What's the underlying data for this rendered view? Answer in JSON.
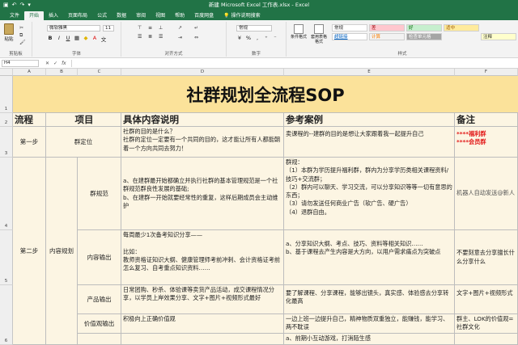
{
  "window": {
    "title": "新建 Microsoft Excel 工作表.xlsx  -  Excel"
  },
  "tabs": [
    "文件",
    "开始",
    "插入",
    "页面布局",
    "公式",
    "数据",
    "审阅",
    "视图",
    "帮助",
    "百度网盘"
  ],
  "tell_me": "操作说明搜索",
  "ribbon": {
    "paste_label": "粘贴",
    "clipboard_label": "剪贴板",
    "font_name": "微软雅黑",
    "font_size": "11",
    "font_label": "字体",
    "alignment_label": "对齐方式",
    "number_format": "常规",
    "number_label": "数字",
    "cond_format_label": "条件格式",
    "table_format_label": "套用表格格式",
    "styles_label": "样式",
    "styles": [
      "常规",
      "差",
      "好",
      "适中",
      "",
      "超链接",
      "计算",
      "检查单元格",
      "",
      "注释"
    ]
  },
  "formula_bar": {
    "name_box": "H4",
    "fx": "fx"
  },
  "columns": [
    "A",
    "B",
    "C",
    "D",
    "E",
    "F"
  ],
  "rows": [
    "1",
    "2",
    "3",
    "4",
    "5",
    "6"
  ],
  "sheet": {
    "title": "社群规划全流程SOP",
    "headers": {
      "a": "流程",
      "b": "项目",
      "d": "具体内容说明",
      "e": "参考案例",
      "f": "备注"
    },
    "row3": {
      "a": "第一步",
      "b": "群定位",
      "d": "社群的目的是什么？\n社群的定位一定要有一个共同的目的，这才能让所有人都能朝着一个方向共同去努力！",
      "e": "卖课程的--建群的目的是想让大家跟着我一起提升自己",
      "f1": "****福利群",
      "f2": "****会员群"
    },
    "row4": {
      "c": "群规范",
      "d": "a、在建群最开始都确立并执行社群的基本管理规范是一个社群规范群良性发展的基础;\nb、在建群一开始就要经常性的重复，这样后期成员会主动维护",
      "e": "群规：\n（1）本群为学历提升福利群，群内为分享学历类相关课程资料/技巧+交流群；\n（2）群内可以聊天、学习交流，可以分享知识等等一切有意思的东西；\n（3）请勿发送任何商业广告（软广告、硬广告）\n（4）退群自由。",
      "f": "机器人自动发送@新人"
    },
    "row5": {
      "a": "第二步",
      "b": "内容规划",
      "c": "内容输出",
      "d": "每周最少1次备考知识分享——\n\n比如：\n教师资格证知识大纲、健康管理师考前冲刺、会计资格证考前怎么复习、自考重点知识资料……",
      "e": "a、分享知识大纲、考点、技巧、资料等相关知识……\nb、基于课程去产生内容是大方向，以用户需求痛点为突破点",
      "f": "不要刻意去分享擅长什么分享什么"
    },
    "row6": {
      "c": "产品输出",
      "d": "日常团购、秒杀、体验课等卖货产品活动，成交课程情况分享，以学员上岸效果分享、文字+图片+视频形式最好",
      "e": "要了解课程、分享课程，能够出镜头，真实感、体验感去分享转化最高",
      "f": "文字+图片+视频形式"
    },
    "row7": {
      "c": "价值观输出",
      "d": "积极向上正确价值观",
      "e": "一边上班一边提升自己，精神物质双重独立，能赚钱，能学习、两不耽误",
      "f": "群主、LOK的价值观=社群文化"
    },
    "row8": {
      "e": "a、前期小互动游戏，打消陌生感"
    }
  }
}
